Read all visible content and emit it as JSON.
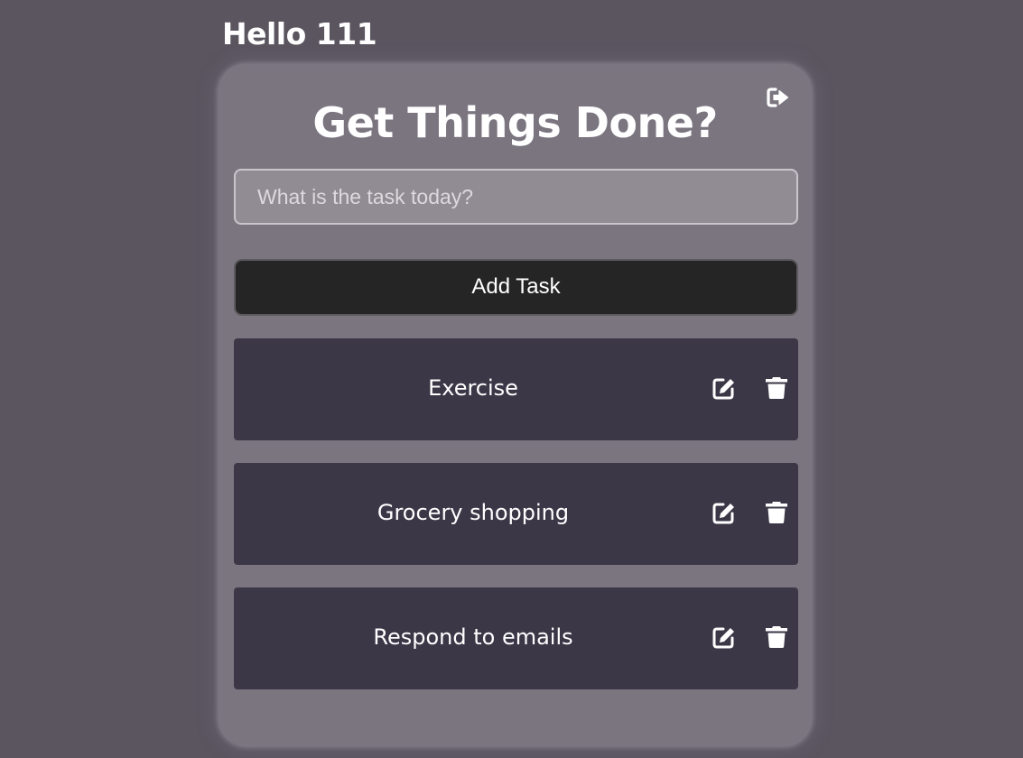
{
  "greeting": "Hello 111",
  "card": {
    "title": "Get Things Done?",
    "input": {
      "placeholder": "What is the task today?",
      "value": ""
    },
    "add_button_label": "Add Task",
    "tasks": [
      {
        "label": "Exercise"
      },
      {
        "label": "Grocery shopping"
      },
      {
        "label": "Respond to emails"
      }
    ]
  },
  "icons": {
    "logout": "logout-icon",
    "edit": "edit-icon",
    "delete": "trash-icon"
  },
  "colors": {
    "background": "#5b5560",
    "card": "#7b7580",
    "task_item": "#3b3747",
    "button": "#252525",
    "text": "#ffffff"
  }
}
